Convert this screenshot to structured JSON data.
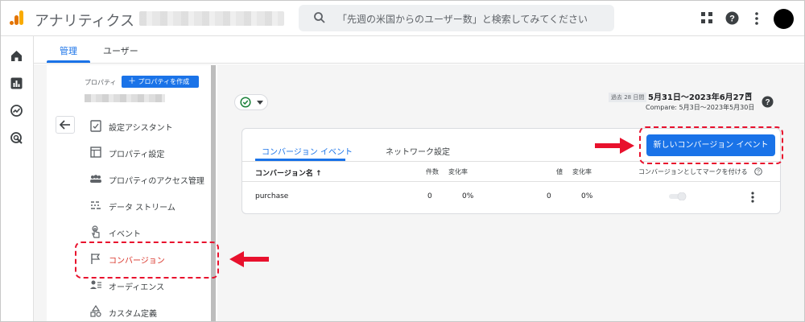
{
  "app": {
    "title": "アナリティクス",
    "search_placeholder": "「先週の米国からのユーザー数」と検索してみてください"
  },
  "tabs": [
    {
      "label": "管理",
      "active": true
    },
    {
      "label": "ユーザー",
      "active": false
    }
  ],
  "property_panel": {
    "label": "プロパティ",
    "create_button": "プロパティを作成",
    "items": [
      {
        "label": "設定アシスタント",
        "icon": "checklist-icon"
      },
      {
        "label": "プロパティ設定",
        "icon": "layout-icon"
      },
      {
        "label": "プロパティのアクセス管理",
        "icon": "people-icon"
      },
      {
        "label": "データ ストリーム",
        "icon": "streams-icon"
      },
      {
        "label": "イベント",
        "icon": "touch-icon"
      },
      {
        "label": "コンバージョン",
        "icon": "flag-icon",
        "active": true
      },
      {
        "label": "オーディエンス",
        "icon": "audience-icon"
      },
      {
        "label": "カスタム定義",
        "icon": "shapes-icon"
      }
    ]
  },
  "date": {
    "tag": "過去 28 日間",
    "range": "5月31日〜2023年6月27日",
    "compare": "Compare: 5月3日〜2023年5月30日"
  },
  "card": {
    "tabs": [
      "コンバージョン イベント",
      "ネットワーク設定"
    ],
    "new_button": "新しいコンバージョン イベント",
    "columns": {
      "name": "コンバージョン名 ↑",
      "count": "件数",
      "count_change": "変化率",
      "value": "値",
      "value_change": "変化率",
      "mark": "コンバージョンとしてマークを付ける"
    },
    "rows": [
      {
        "name": "purchase",
        "count": "0",
        "count_change": "0%",
        "value": "0",
        "value_change": "0%"
      }
    ]
  },
  "colors": {
    "accent": "#1a73e8",
    "annotation": "#e8112d",
    "active_nav": "#d93025"
  }
}
